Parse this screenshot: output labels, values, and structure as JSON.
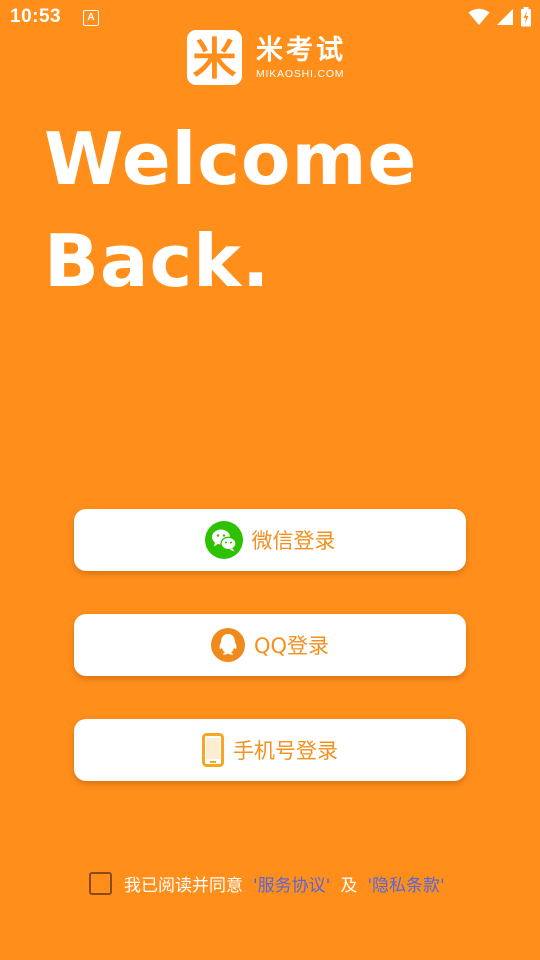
{
  "status_bar": {
    "time": "10:53",
    "notification_glyph": "A",
    "icons": [
      "wifi-icon",
      "signal-icon",
      "battery-charging-icon"
    ]
  },
  "brand": {
    "logo_char": "米",
    "name": "米考试",
    "domain": "MIKAOSHI.COM"
  },
  "welcome": {
    "line1": "Welcome",
    "line2": "Back."
  },
  "login_options": [
    {
      "label": "微信登录",
      "icon": "wechat-icon"
    },
    {
      "label": "QQ登录",
      "icon": "qq-icon"
    },
    {
      "label": "手机号登录",
      "icon": "phone-icon"
    }
  ],
  "agreement": {
    "checked": false,
    "prefix": "我已阅读并同意",
    "service_link": "'服务协议'",
    "conjunction": "及",
    "privacy_link": "'隐私条款'"
  },
  "colors": {
    "background": "#FF8E1B",
    "button_text": "#F3901E",
    "link": "#5866D6",
    "wechat_green": "#2DC100",
    "qq_orange": "#F08A1C",
    "phone_orange": "#F5A623"
  }
}
